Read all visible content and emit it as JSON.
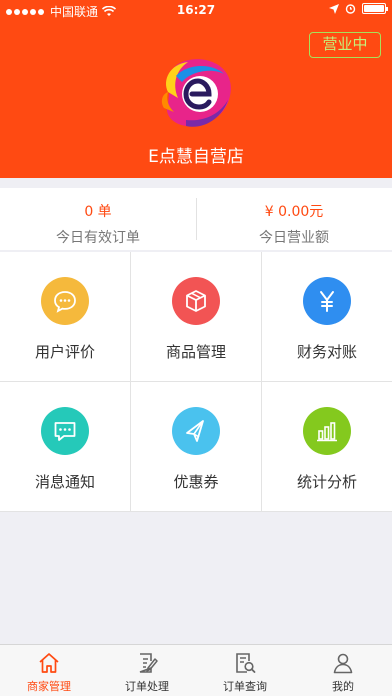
{
  "status_bar": {
    "carrier": "中国联通",
    "time": "16:27"
  },
  "header": {
    "status_button": "营业中",
    "store_name": "E点慧自营店"
  },
  "stats": [
    {
      "value": "0 单",
      "label": "今日有效订单"
    },
    {
      "value": "¥ 0.00元",
      "label": "今日营业额"
    }
  ],
  "grid": [
    {
      "label": "用户评价",
      "icon": "chat-bubble-icon",
      "color": "#f5b93c"
    },
    {
      "label": "商品管理",
      "icon": "box-icon",
      "color": "#f25454"
    },
    {
      "label": "财务对账",
      "icon": "yuan-icon",
      "color": "#2f8ef0"
    },
    {
      "label": "消息通知",
      "icon": "message-icon",
      "color": "#25c9b9"
    },
    {
      "label": "优惠券",
      "icon": "paper-plane-icon",
      "color": "#4ac2ee"
    },
    {
      "label": "统计分析",
      "icon": "bar-chart-icon",
      "color": "#84c91e"
    }
  ],
  "tabs": [
    {
      "label": "商家管理",
      "icon": "home-icon",
      "active": true
    },
    {
      "label": "订单处理",
      "icon": "edit-order-icon",
      "active": false
    },
    {
      "label": "订单查询",
      "icon": "search-document-icon",
      "active": false
    },
    {
      "label": "我的",
      "icon": "user-icon",
      "active": false
    }
  ],
  "colors": {
    "brand": "#ff4a12",
    "status_button": "#a8e05a"
  }
}
